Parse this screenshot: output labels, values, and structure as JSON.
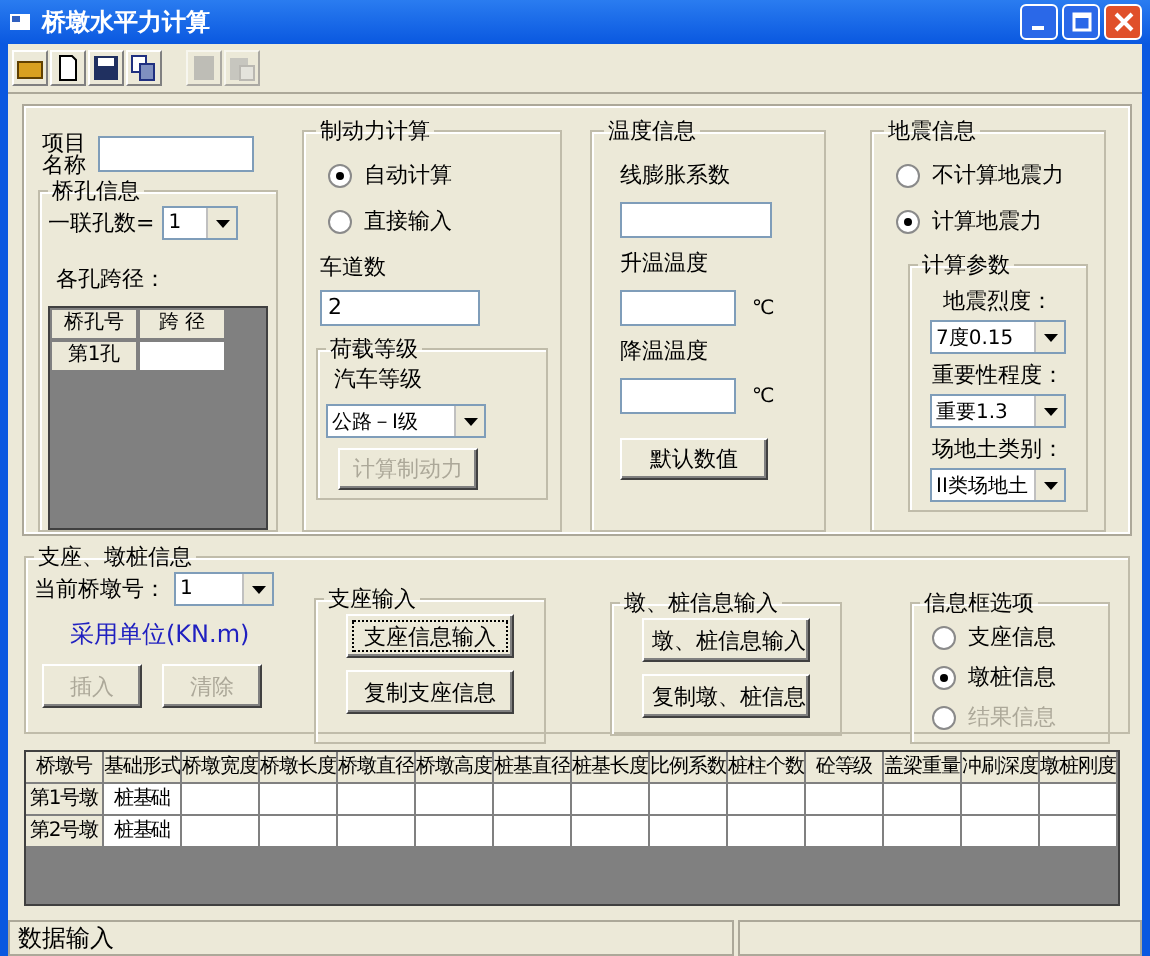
{
  "window": {
    "title": "桥墩水平力计算"
  },
  "toolbar": [
    {
      "kind": "open",
      "disabled": false
    },
    {
      "kind": "new",
      "disabled": false
    },
    {
      "kind": "save",
      "disabled": false
    },
    {
      "kind": "copy",
      "disabled": false
    },
    {
      "kind": "doc",
      "disabled": true
    },
    {
      "kind": "paste",
      "disabled": true
    }
  ],
  "project": {
    "label": "项目名称"
  },
  "span_info": {
    "title": "桥孔信息",
    "count_label": "一联孔数=",
    "count_value": "1",
    "spans_label": "各孔跨径：",
    "columns": [
      "桥孔号",
      "跨 径"
    ],
    "rows": [
      {
        "name": "第1孔"
      }
    ]
  },
  "braking": {
    "title": "制动力计算",
    "modes": [
      {
        "label": "自动计算",
        "selected": true
      },
      {
        "label": "直接输入",
        "selected": false
      }
    ],
    "lanes_label": "车道数",
    "lanes_value": "2",
    "load": {
      "title": "荷载等级",
      "label": "汽车等级",
      "value": "公路－I级"
    },
    "button": {
      "label": "计算制动力",
      "disabled": true
    }
  },
  "temperature": {
    "title": "温度信息",
    "fields": [
      {
        "label": "线膨胀系数"
      },
      {
        "label": "升温温度",
        "unit": "℃"
      },
      {
        "label": "降温温度",
        "unit": "℃"
      }
    ],
    "button": "默认数值"
  },
  "seismic": {
    "title": "地震信息",
    "modes": [
      {
        "label": "不计算地震力",
        "selected": false
      },
      {
        "label": "计算地震力",
        "selected": true
      }
    ],
    "params": {
      "title": "计算参数",
      "fields": [
        {
          "label": "地震烈度：",
          "value": "7度0.15"
        },
        {
          "label": "重要性程度：",
          "value": "重要1.3"
        },
        {
          "label": "场地土类别：",
          "value": "II类场地土"
        }
      ]
    }
  },
  "support": {
    "title": "支座、墩桩信息",
    "pier_label": "当前桥墩号：",
    "pier_value": "1",
    "units": "采用单位(KN.m)",
    "buttons": [
      {
        "label": "插入",
        "disabled": true
      },
      {
        "label": "清除",
        "disabled": true
      }
    ]
  },
  "bearing_input": {
    "title": "支座输入",
    "buttons": [
      {
        "label": "支座信息输入",
        "focused": true
      },
      {
        "label": "复制支座信息",
        "focused": false
      }
    ]
  },
  "pier_input": {
    "title": "墩、桩信息输入",
    "buttons": [
      "墩、桩信息输入",
      "复制墩、桩信息"
    ]
  },
  "info_options": {
    "title": "信息框选项",
    "options": [
      {
        "label": "支座信息",
        "selected": false,
        "disabled": false
      },
      {
        "label": "墩桩信息",
        "selected": true,
        "disabled": false
      },
      {
        "label": "结果信息",
        "selected": false,
        "disabled": true
      }
    ]
  },
  "table": {
    "columns": [
      "桥墩号",
      "基础形式",
      "桥墩宽度",
      "桥墩长度",
      "桥墩直径",
      "桥墩高度",
      "桩基直径",
      "桩基长度",
      "比例系数",
      "桩柱个数",
      "砼等级",
      "盖梁重量",
      "冲刷深度",
      "墩桩刚度"
    ],
    "rows": [
      {
        "cells": [
          "第1号墩",
          "桩基础"
        ]
      },
      {
        "cells": [
          "第2号墩",
          "桩基础"
        ]
      }
    ]
  },
  "status_bar": {
    "text": "数据输入"
  }
}
